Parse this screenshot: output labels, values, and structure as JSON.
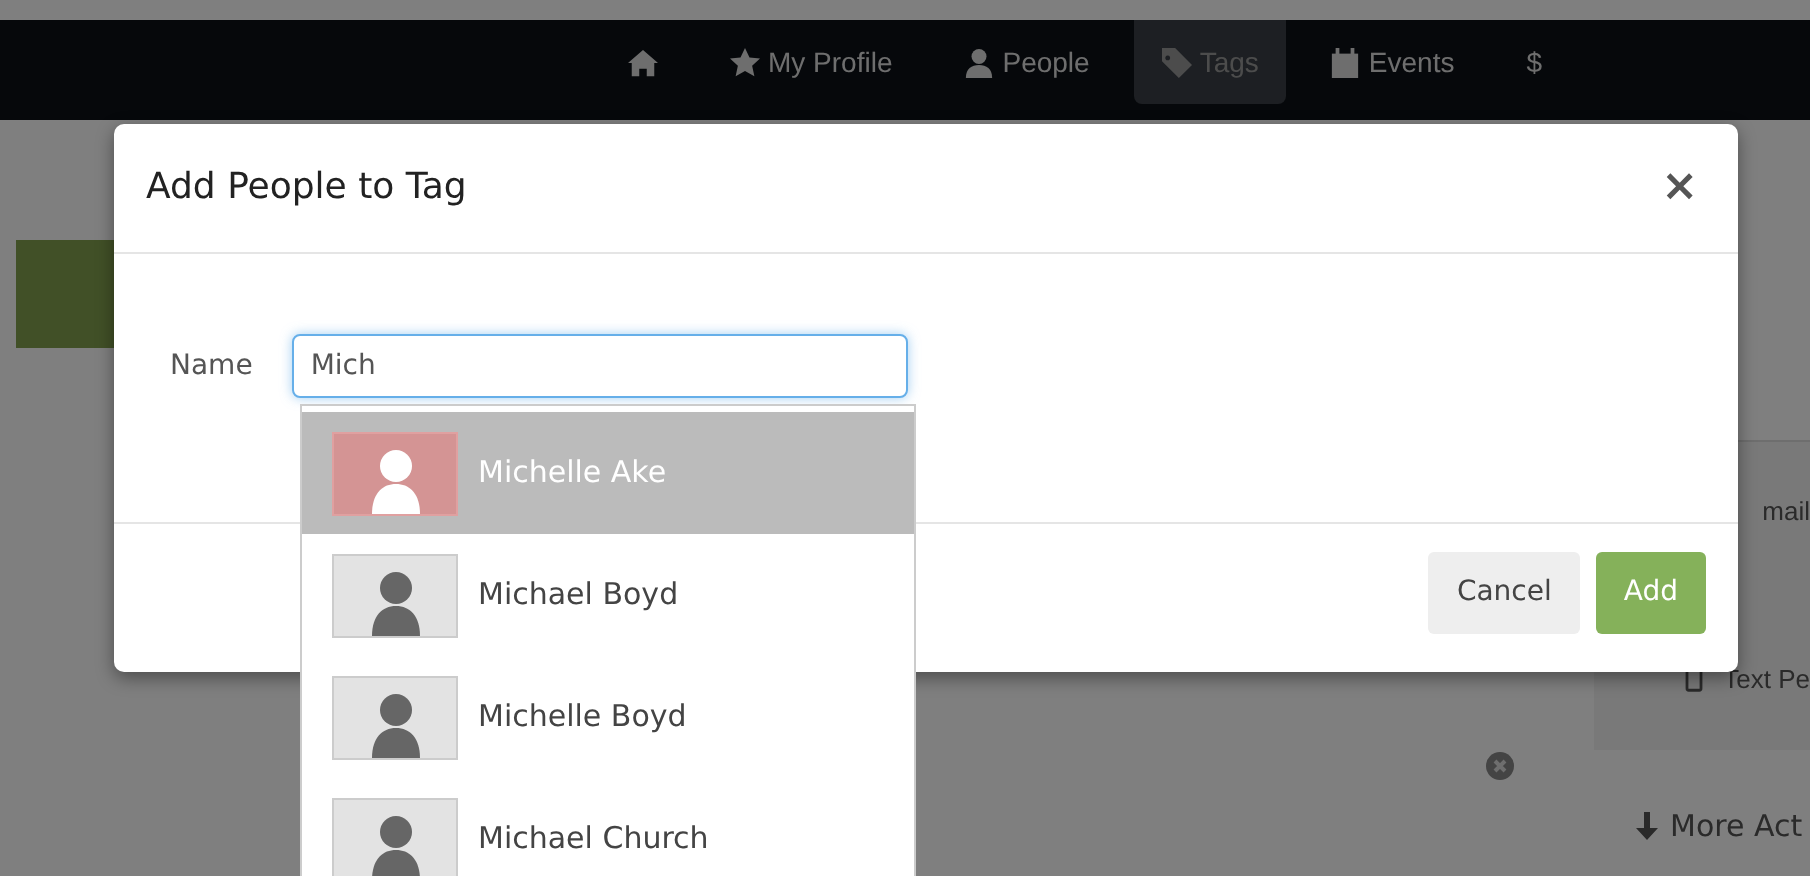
{
  "navbar": {
    "items": [
      {
        "selected": false
      },
      {
        "label": "My Profile",
        "selected": false
      },
      {
        "label": "People",
        "selected": false
      },
      {
        "label": "Tags",
        "selected": true
      },
      {
        "label": "Events",
        "selected": false
      },
      {
        "label": "$",
        "selected": false
      }
    ]
  },
  "background": {
    "side_panel": [
      {
        "label": "mail"
      },
      {
        "label": "Text Pe"
      }
    ],
    "more_actions": "More Act"
  },
  "modal": {
    "title": "Add People to Tag",
    "close": "×",
    "field_label": "Name",
    "field_value": "Mich",
    "suggestions": [
      {
        "name": "Michelle Ake",
        "selected": true
      },
      {
        "name": "Michael Boyd",
        "selected": false
      },
      {
        "name": "Michelle Boyd",
        "selected": false
      },
      {
        "name": "Michael Church",
        "selected": false
      }
    ],
    "buttons": [
      {
        "kind": "secondary",
        "label": "Cancel"
      },
      {
        "kind": "primary",
        "label": "Add"
      }
    ]
  }
}
